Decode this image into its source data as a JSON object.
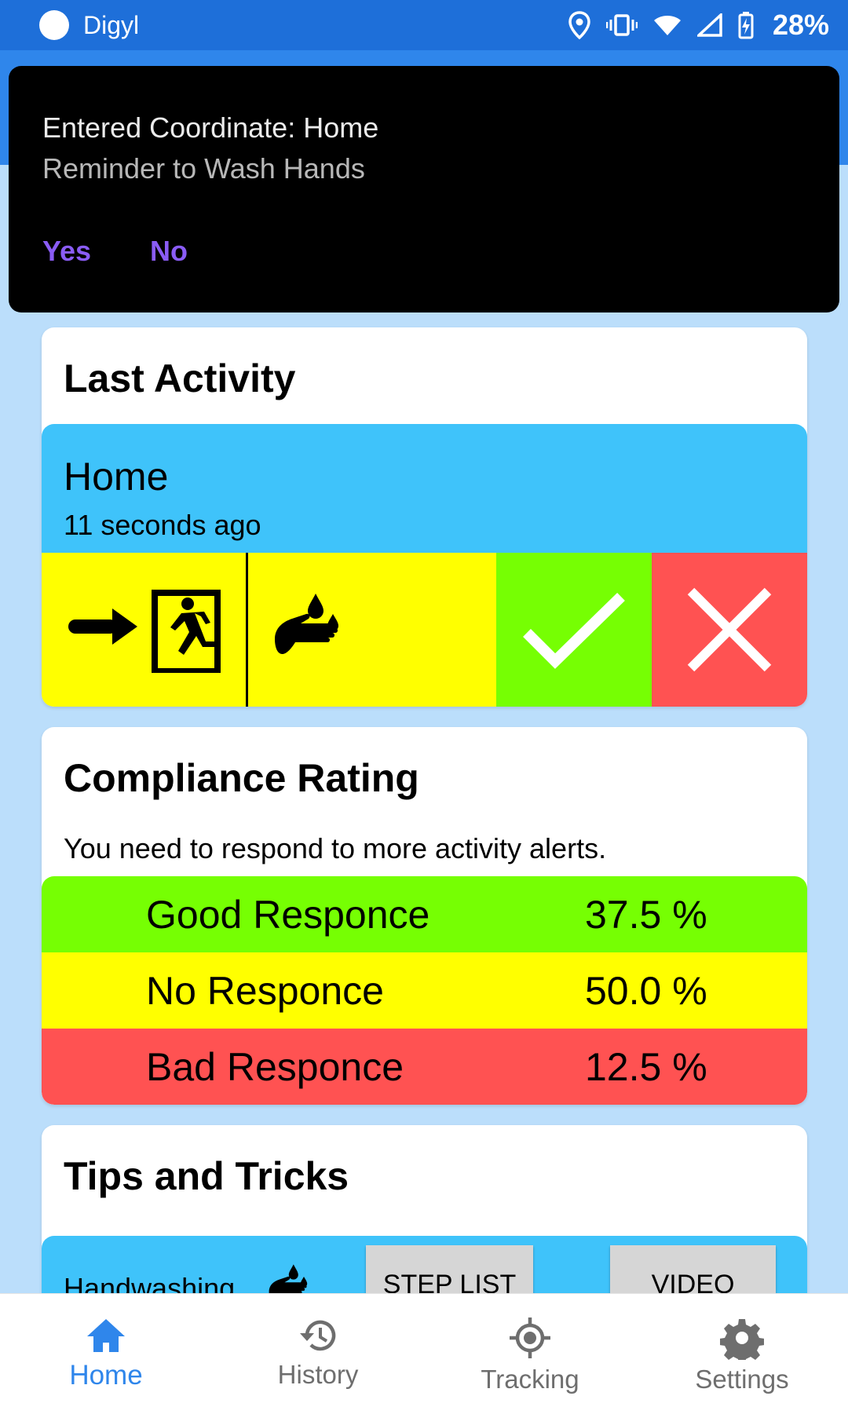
{
  "status_bar": {
    "app_name": "Digyl",
    "battery": "28%"
  },
  "notification": {
    "title": "Entered Coordinate: Home",
    "text": "Reminder to Wash Hands",
    "yes_label": "Yes",
    "no_label": "No"
  },
  "last_activity": {
    "title": "Last Activity",
    "place": "Home",
    "time_ago": "11 seconds ago"
  },
  "compliance": {
    "title": "Compliance Rating",
    "message": "You need to respond to more activity alerts.",
    "rows": [
      {
        "label": "Good Responce",
        "value": "37.5 %",
        "color": "#76ff03"
      },
      {
        "label": "No Responce",
        "value": "50.0 %",
        "color": "#ffff00"
      },
      {
        "label": "Bad Responce",
        "value": "12.5 %",
        "color": "#ff5252"
      }
    ]
  },
  "tips": {
    "title": "Tips and Tricks",
    "item_label": "Handwashing",
    "step_list_label": "STEP LIST",
    "video_label": "VIDEO"
  },
  "bottom_nav": {
    "items": [
      {
        "label": "Home",
        "icon": "home-icon",
        "active": true
      },
      {
        "label": "History",
        "icon": "history-icon",
        "active": false
      },
      {
        "label": "Tracking",
        "icon": "gps-icon",
        "active": false
      },
      {
        "label": "Settings",
        "icon": "gear-icon",
        "active": false
      }
    ]
  },
  "colors": {
    "primary": "#2f86eb",
    "status_bar": "#1e6fd9",
    "background": "#bbdefb",
    "accent_light_blue": "#3fc3fa",
    "good": "#76ff03",
    "neutral": "#ffff00",
    "bad": "#ff5252"
  }
}
